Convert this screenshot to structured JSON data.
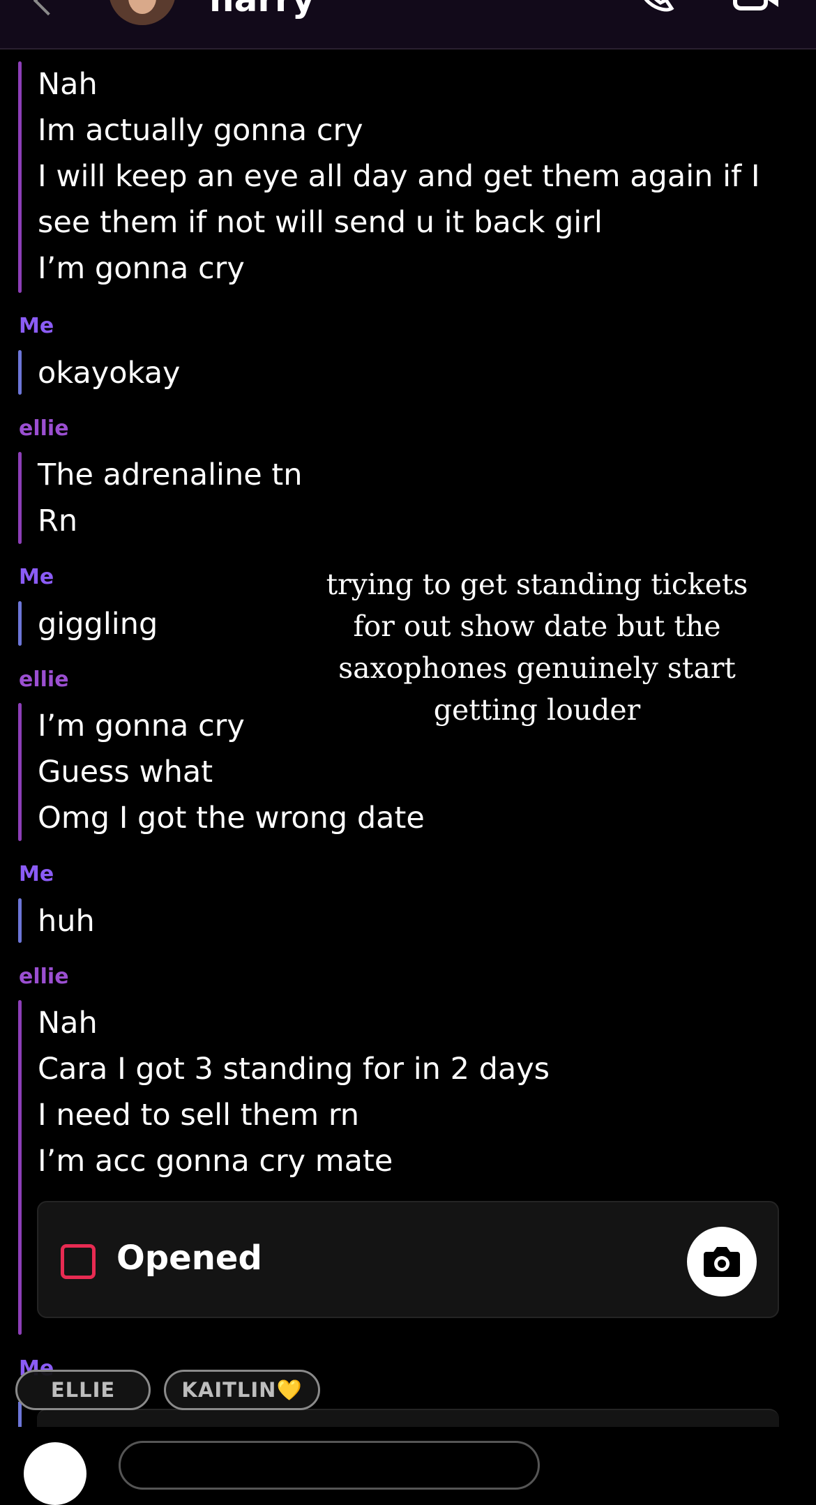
{
  "header": {
    "name": "harry"
  },
  "messages": [
    {
      "sender": "",
      "lines": [
        "Nah",
        "Im actually gonna cry",
        "I will keep an eye all day and get them again if I",
        "see them if not will send u it back girl",
        "I’m gonna cry"
      ]
    },
    {
      "sender": "Me",
      "lines": [
        "okayokay"
      ]
    },
    {
      "sender": "ellie",
      "lines": [
        "The adrenaline tn",
        "Rn"
      ]
    },
    {
      "sender": "Me",
      "lines": [
        "giggling"
      ]
    },
    {
      "sender": "ellie",
      "lines": [
        "I’m gonna cry",
        "Guess what",
        "Omg I got the wrong date"
      ]
    },
    {
      "sender": "Me",
      "lines": [
        "huh"
      ]
    },
    {
      "sender": "ellie",
      "lines": [
        "Nah",
        "Cara I got 3 standing for in 2 days",
        "I need to sell them rn",
        "I’m acc gonna cry mate"
      ]
    }
  ],
  "overlay_caption": [
    "trying to get standing tickets",
    "for out show date but the",
    "saxophones genuinely start",
    "getting louder"
  ],
  "opened_card": {
    "label": "Opened",
    "icon": "opened-square-icon",
    "action_icon": "camera-icon"
  },
  "partial_sender": "Me",
  "chips": [
    "ELLIE",
    "KAITLIN💛"
  ],
  "colors": {
    "accent_me": "#8b5cf6",
    "accent_friend": "#9b4fd1",
    "opened_red": "#e82b52"
  }
}
